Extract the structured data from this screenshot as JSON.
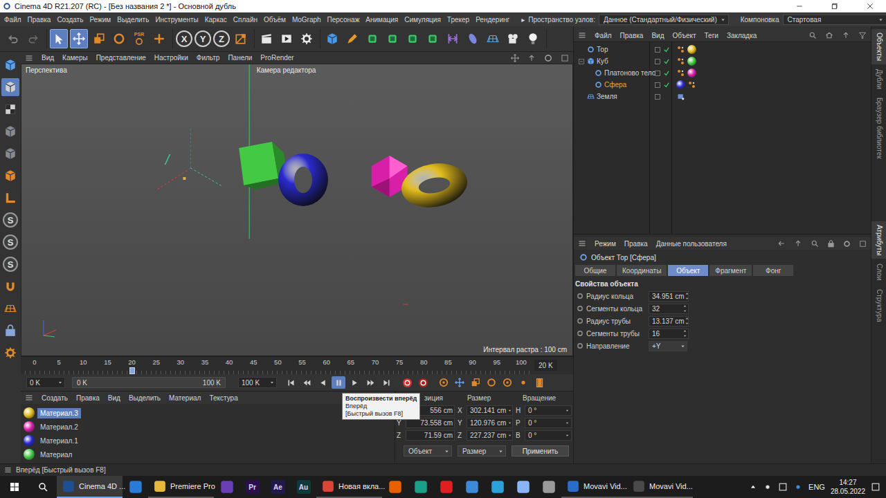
{
  "window": {
    "title": "Cinema 4D R21.207 (RC) - [Без названия 2 *] - Основной дубль"
  },
  "menu": [
    "Файл",
    "Правка",
    "Создать",
    "Режим",
    "Выделить",
    "Инструменты",
    "Каркас",
    "Сплайн",
    "Объём",
    "MoGraph",
    "Персонаж",
    "Анимация",
    "Симуляция",
    "Трекер",
    "Рендеринг"
  ],
  "node_space": {
    "arrow": "▸",
    "label": "Пространство узлов:",
    "value": "Данное (Стандартный/Физический)"
  },
  "layout_select": {
    "label": "Компоновка",
    "value": "Стартовая"
  },
  "toolbar": {
    "modes": [
      {
        "selected": true
      },
      {
        "selected": true
      },
      {
        "selected": false
      },
      {
        "selected": false
      }
    ],
    "psr": "PSR",
    "axes": [
      "X",
      "Y",
      "Z"
    ]
  },
  "left_tools": [
    {
      "kind": "icon",
      "selected": false
    },
    {
      "kind": "icon",
      "selected": true
    },
    {
      "kind": "icon",
      "selected": false
    },
    {
      "kind": "icon",
      "selected": false
    },
    {
      "kind": "icon",
      "selected": false
    },
    {
      "kind": "icon",
      "selected": false
    },
    {
      "kind": "icon",
      "selected": false
    },
    {
      "kind": "letter",
      "text": "S",
      "selected": false
    },
    {
      "kind": "letter",
      "text": "S",
      "selected": false
    },
    {
      "kind": "letter",
      "text": "S",
      "selected": false
    },
    {
      "kind": "icon",
      "selected": false
    },
    {
      "kind": "icon",
      "selected": false
    },
    {
      "kind": "icon",
      "selected": false
    },
    {
      "kind": "icon",
      "selected": false
    }
  ],
  "viewport": {
    "menu": [
      "Вид",
      "Камеры",
      "Представление",
      "Настройки",
      "Фильтр",
      "Панели",
      "ProRender"
    ],
    "view": "Перспектива",
    "camera": "Камера редактора",
    "grid": "Интервал растра : 100 cm",
    "objects": [
      {
        "kind": "cube",
        "color": "#44c944"
      },
      {
        "kind": "torus",
        "color": "#2a2ad0"
      },
      {
        "kind": "polyhedron",
        "color": "#d81fa8"
      },
      {
        "kind": "torus",
        "color": "#e2bb1c"
      }
    ]
  },
  "timeline": {
    "ticks": [
      "0",
      "5",
      "10",
      "15",
      "20",
      "25",
      "30",
      "35",
      "40",
      "45",
      "50",
      "55",
      "60",
      "65",
      "70",
      "75",
      "80",
      "85",
      "90",
      "95",
      "100"
    ],
    "level": 0.2,
    "frame": "20 K"
  },
  "transport": {
    "start": "0 K",
    "range_start": "0 K",
    "range_end": "100 K",
    "end": "100 K",
    "playing": true
  },
  "tooltip": {
    "title": "Воспроизвести вперёд",
    "lines": [
      "Вперёд",
      "[Быстрый вызов F8]"
    ]
  },
  "materials": {
    "menu": [
      "Создать",
      "Правка",
      "Вид",
      "Выделить",
      "Материал",
      "Текстура"
    ],
    "items": [
      {
        "name": "Материал.3",
        "color": "#e2bb1c",
        "selected": true
      },
      {
        "name": "Материал.2",
        "color": "#d81fa8",
        "selected": false
      },
      {
        "name": "Материал.1",
        "color": "#2a2ad0",
        "selected": false
      },
      {
        "name": "Материал",
        "color": "#44c944",
        "selected": false
      }
    ]
  },
  "coordinates": {
    "headers": [
      "зиция",
      "Размер",
      "Вращение"
    ],
    "rows": [
      {
        "pos_value": "556 cm",
        "size_axis": "X",
        "size": "302.141 cm",
        "rot_axis": "H",
        "rot": "0 °"
      },
      {
        "pos_axis": "Y",
        "pos_value": "73.558 cm",
        "size_axis": "Y",
        "size": "120.976 cm",
        "rot_axis": "P",
        "rot": "0 °"
      },
      {
        "pos_axis": "Z",
        "pos_value": "71.59 cm",
        "size_axis": "Z",
        "size": "227.237 cm",
        "rot_axis": "B",
        "rot": "0 °"
      }
    ],
    "mode": "Объект",
    "size_mode": "Размер",
    "apply": "Применить"
  },
  "status_bar": "Вперёд [Быстрый вызов F8]",
  "objects": {
    "menu": [
      "Файл",
      "Правка",
      "Вид",
      "Объект",
      "Теги",
      "Закладка"
    ],
    "items": [
      {
        "name": "Тор",
        "depth": 0,
        "expandable": false,
        "expanded": false,
        "selected": false,
        "enabled": true,
        "tags": [
          {
            "kind": "phong"
          },
          {
            "kind": "material",
            "color": "#e2bb1c"
          }
        ]
      },
      {
        "name": "Куб",
        "depth": 0,
        "expandable": true,
        "expanded": true,
        "selected": false,
        "enabled": true,
        "tags": [
          {
            "kind": "phong"
          },
          {
            "kind": "material",
            "color": "#44c944"
          }
        ]
      },
      {
        "name": "Платоново тело",
        "depth": 1,
        "expandable": false,
        "expanded": false,
        "selected": false,
        "enabled": true,
        "tags": [
          {
            "kind": "phong"
          },
          {
            "kind": "material",
            "color": "#d81fa8"
          }
        ]
      },
      {
        "name": "Сфера",
        "depth": 1,
        "expandable": false,
        "expanded": false,
        "selected": true,
        "enabled": true,
        "tags": [
          {
            "kind": "material",
            "color": "#2a2ad0"
          },
          {
            "kind": "phong"
          }
        ]
      },
      {
        "name": "Земля",
        "depth": 0,
        "expandable": false,
        "expanded": false,
        "selected": false,
        "enabled": false,
        "tags": [
          {
            "kind": "display"
          }
        ]
      }
    ]
  },
  "attributes": {
    "menu": [
      "Режим",
      "Правка",
      "Данные пользователя"
    ],
    "title": "Объект Тор [Сфера]",
    "tabs": [
      {
        "label": "Общие",
        "selected": false
      },
      {
        "label": "Координаты",
        "selected": false
      },
      {
        "label": "Объект",
        "selected": true
      },
      {
        "label": "Фрагмент",
        "selected": false
      },
      {
        "label": "Фонг",
        "selected": false
      }
    ],
    "section": "Свойства объекта",
    "fields": [
      {
        "label": "Радиус кольца",
        "value": "34.951 cm",
        "kind": "number"
      },
      {
        "label": "Сегменты кольца",
        "value": "32",
        "kind": "number"
      },
      {
        "label": "Радиус трубы",
        "value": "13.137 cm",
        "kind": "number"
      },
      {
        "label": "Сегменты трубы",
        "value": "16",
        "kind": "number"
      },
      {
        "label": "Направление",
        "value": "+Y",
        "kind": "select"
      }
    ]
  },
  "side_tabs": {
    "top": [
      {
        "label": "Объекты",
        "selected": true
      },
      {
        "label": "Дубли",
        "selected": false
      },
      {
        "label": "Браузер библиотек",
        "selected": false
      }
    ],
    "bottom": [
      {
        "label": "Атрибуты",
        "selected": true
      },
      {
        "label": "Слои",
        "selected": false
      },
      {
        "label": "Структура",
        "selected": false
      }
    ]
  },
  "taskbar": {
    "apps": [
      {
        "kind": "app",
        "label": "Cinema 4D ...",
        "color": "#1d4f91",
        "selected": true
      },
      {
        "kind": "icon",
        "color": "#2a7ad8",
        "selected": false
      },
      {
        "kind": "app",
        "label": "Premiere Pro",
        "color": "#e8b83a",
        "selected": false
      },
      {
        "kind": "icon",
        "color": "#6a3fb5",
        "selected": false
      },
      {
        "kind": "icon",
        "text": "Pr",
        "color": "#2a0f4a",
        "selected": false
      },
      {
        "kind": "icon",
        "text": "Ae",
        "color": "#1f1a4a",
        "selected": false
      },
      {
        "kind": "icon",
        "text": "Au",
        "color": "#0c3b3a",
        "selected": false
      },
      {
        "kind": "app",
        "label": "Новая вкла...",
        "color": "#db4437",
        "selected": false
      },
      {
        "kind": "icon",
        "color": "#e66000",
        "selected": false
      },
      {
        "kind": "icon",
        "color": "#1aa08a",
        "selected": false
      },
      {
        "kind": "icon",
        "color": "#e02020",
        "selected": false
      },
      {
        "kind": "icon",
        "color": "#3c8ad8",
        "selected": false
      },
      {
        "kind": "icon",
        "color": "#2aa1da",
        "selected": false
      },
      {
        "kind": "icon",
        "color": "#8ab4f8",
        "selected": false
      },
      {
        "kind": "icon",
        "color": "#9a9a9a",
        "selected": false
      },
      {
        "kind": "app",
        "label": "Movavi Vid...",
        "color": "#2a6cc8",
        "selected": false
      },
      {
        "kind": "app",
        "label": "Movavi Vid...",
        "color": "#4a4a4a",
        "selected": false
      }
    ],
    "language": "ENG",
    "time": "14:27",
    "date": "28.05.2022"
  }
}
